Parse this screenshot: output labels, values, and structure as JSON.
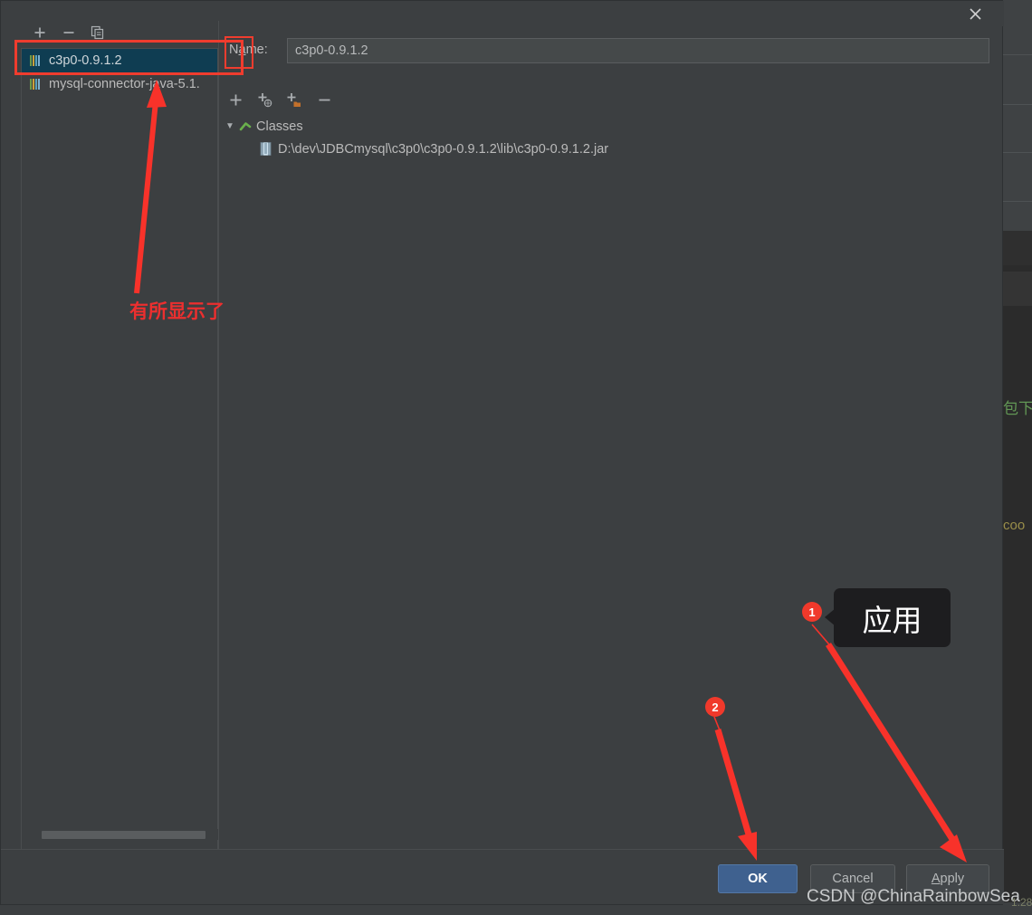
{
  "dialog": {
    "close_icon": "close-icon",
    "name_label_pre": "N",
    "name_label_underlined": "a",
    "name_label_post": "me:",
    "name_value": "c3p0-0.9.1.2",
    "name_placeholder": ""
  },
  "left_panel": {
    "toolbar": [
      {
        "name": "add-library-button",
        "glyph": "+"
      },
      {
        "name": "remove-library-button",
        "glyph": "−"
      },
      {
        "name": "copy-library-button",
        "glyph": "copy-icon"
      }
    ],
    "items": [
      {
        "label": "c3p0-0.9.1.2",
        "selected": true,
        "icon": "library-jar-icon"
      },
      {
        "label": "mysql-connector-java-5.1.",
        "selected": false,
        "icon": "library-jar-icon"
      }
    ],
    "scrollbar": "horizontal-scrollbar"
  },
  "roots_toolbar": [
    {
      "name": "add-root-button",
      "glyph": "+"
    },
    {
      "name": "add-url-root-button",
      "glyph": "+°"
    },
    {
      "name": "add-folder-root-button",
      "glyph": "+■"
    },
    {
      "name": "remove-root-button",
      "glyph": "−"
    }
  ],
  "tree": {
    "root": {
      "label": "Classes",
      "expanded": true,
      "twisty": "▼",
      "icon": "classes-root-icon"
    },
    "children": [
      {
        "label": "D:\\dev\\JDBCmysql\\c3p0\\c3p0-0.9.1.2\\lib\\c3p0-0.9.1.2.jar",
        "icon": "jar-file-icon"
      }
    ]
  },
  "buttons": {
    "ok": "OK",
    "cancel": "Cancel",
    "apply_pre": "",
    "apply_underlined": "A",
    "apply_post": "pply"
  },
  "annotations": {
    "red_box_list": "highlight-selected-library",
    "red_box_name": "highlight-name-label",
    "arrow_to_list": "red-arrow-up",
    "note_cn": "有所显示了",
    "badge_1": "1",
    "badge_2": "2",
    "tooltip_apply": "应用",
    "arrow_to_apply": "red-arrow-to-apply",
    "arrow_to_ok": "red-arrow-to-ok"
  },
  "watermark": {
    "text": "CSDN @ChinaRainbowSea",
    "fragment": "1.28"
  },
  "background": {
    "code_fragment_1": "包下",
    "code_fragment_2": "coo"
  },
  "colors": {
    "dialog_bg": "#3c3f41",
    "selection_bg": "#0f3d52",
    "accent_blue": "#3f618f",
    "annotation_red": "#f0392b",
    "editor_bg": "#2b2b2b"
  }
}
